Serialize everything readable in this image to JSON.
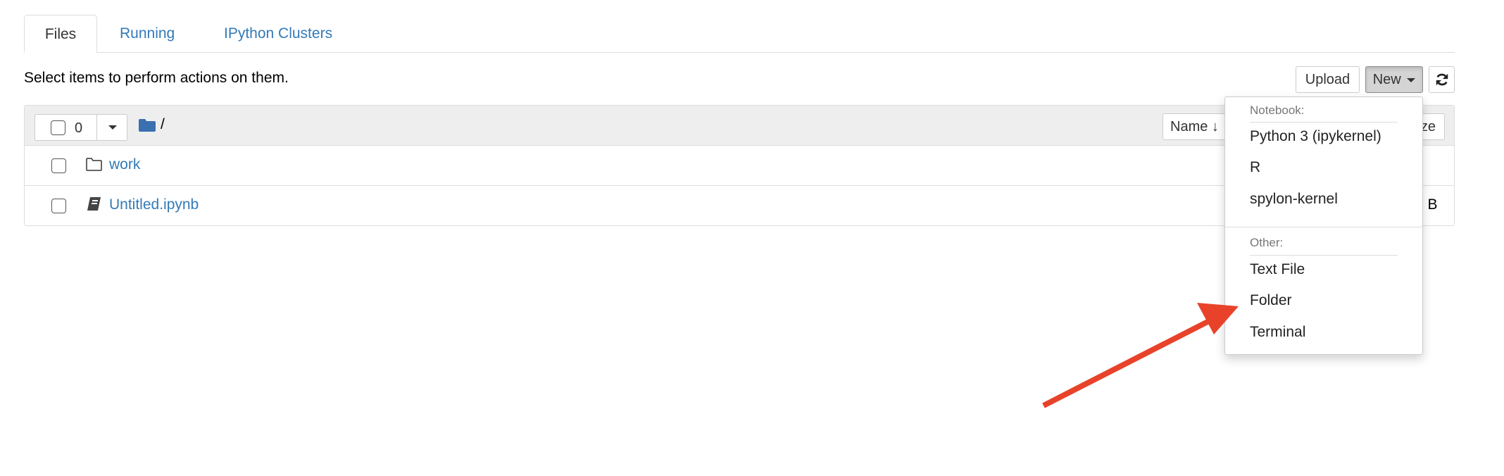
{
  "tabs": [
    {
      "label": "Files",
      "active": true
    },
    {
      "label": "Running",
      "active": false
    },
    {
      "label": "IPython Clusters",
      "active": false
    }
  ],
  "toolbar": {
    "instruction": "Select items to perform actions on them.",
    "upload_label": "Upload",
    "new_label": "New",
    "refresh_icon": "refresh-icon"
  },
  "file_list": {
    "selected_count": "0",
    "breadcrumb": "/",
    "sort_name_label": "Name",
    "size_label_partial": "ze",
    "items": [
      {
        "name": "work",
        "icon": "folder-icon",
        "size": ""
      },
      {
        "name": "Untitled.ipynb",
        "icon": "notebook-icon",
        "size_partial": "5 B"
      }
    ]
  },
  "new_menu": {
    "notebook_header": "Notebook:",
    "notebook_items": [
      "Python 3 (ipykernel)",
      "R",
      "spylon-kernel"
    ],
    "other_header": "Other:",
    "other_items": [
      "Text File",
      "Folder",
      "Terminal"
    ]
  },
  "colors": {
    "link": "#337ab7",
    "annotation_arrow": "#e8432a",
    "new_button_active": "#d4d4d4"
  }
}
